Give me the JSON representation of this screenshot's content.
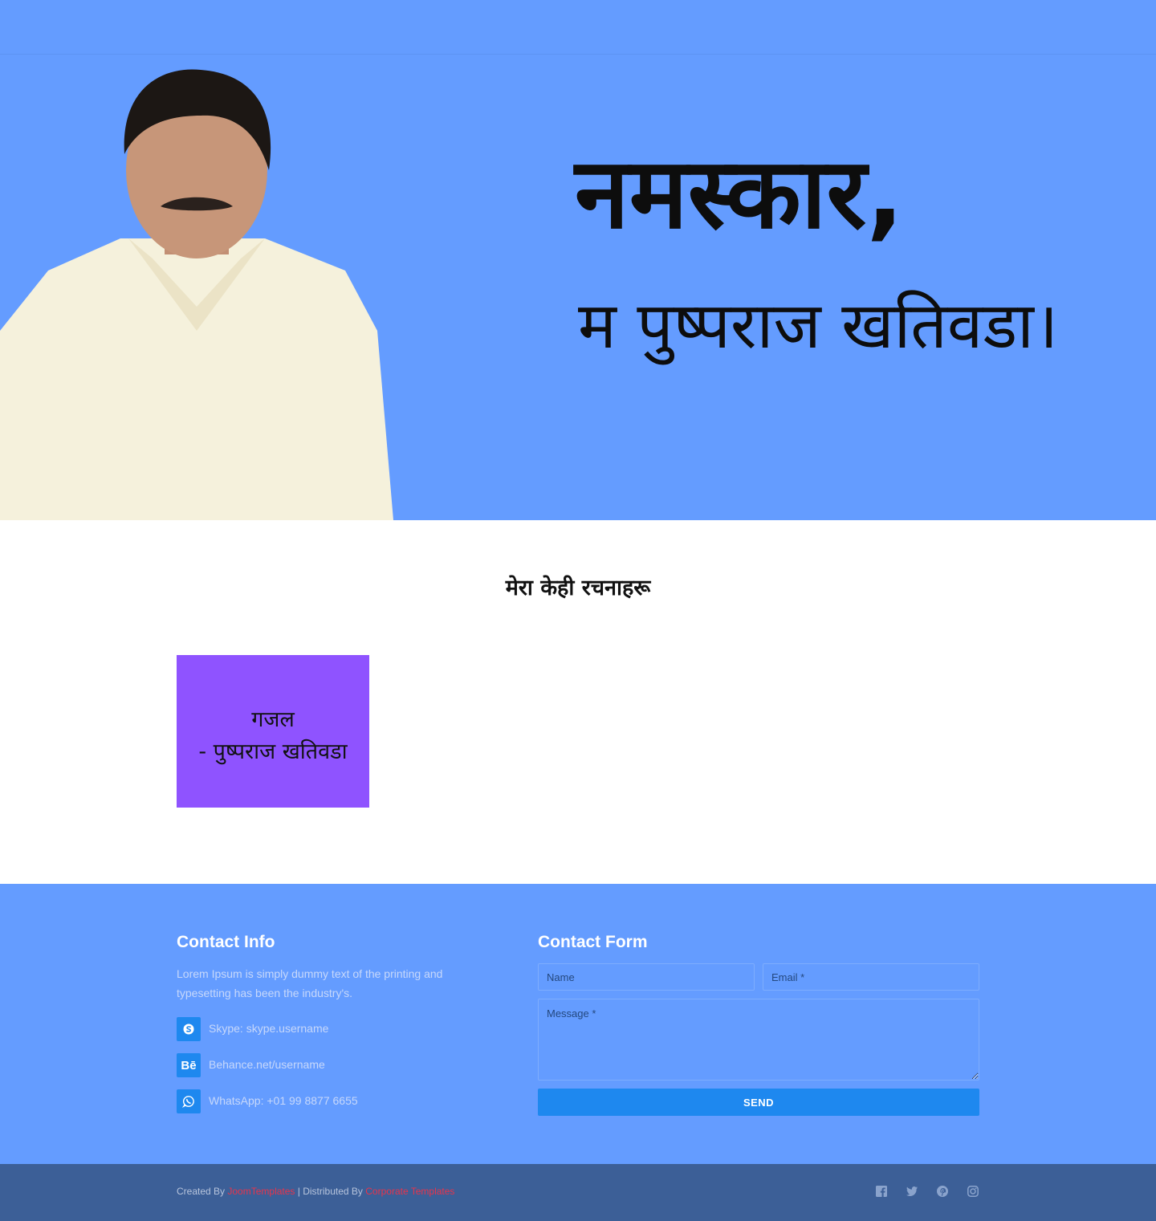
{
  "hero": {
    "greeting": "नमस्कार,",
    "name_line": "म पुष्पराज खतिवडा।"
  },
  "posts": {
    "section_title": "मेरा केही रचनाहरू",
    "items": [
      {
        "line1": "गजल",
        "line2": "- पुष्पराज खतिवडा"
      }
    ]
  },
  "contact_info": {
    "title": "Contact Info",
    "text": "Lorem Ipsum is simply dummy text of the printing and typesetting has been the industry's.",
    "items": [
      {
        "icon": "skype-icon",
        "label": "Skype: skype.username"
      },
      {
        "icon": "behance-icon",
        "label": "Behance.net/username"
      },
      {
        "icon": "whatsapp-icon",
        "label": "WhatsApp: +01 99 8877 6655"
      }
    ]
  },
  "contact_form": {
    "title": "Contact Form",
    "name_placeholder": "Name",
    "email_placeholder": "Email *",
    "message_placeholder": "Message *",
    "send_label": "Send"
  },
  "footer": {
    "created_by": "Created By",
    "creator_link": "JoomTemplates",
    "distributed_by": "| Distributed By",
    "distributor_link": "Corporate Templates",
    "socials": [
      "facebook-icon",
      "twitter-icon",
      "pinterest-icon",
      "instagram-icon"
    ]
  },
  "colors": {
    "hero_bg": "#649cff",
    "card_bg": "#8f53ff",
    "accent": "#1e88ef",
    "footer_bg": "#3c5f97",
    "link": "#e7344c"
  }
}
